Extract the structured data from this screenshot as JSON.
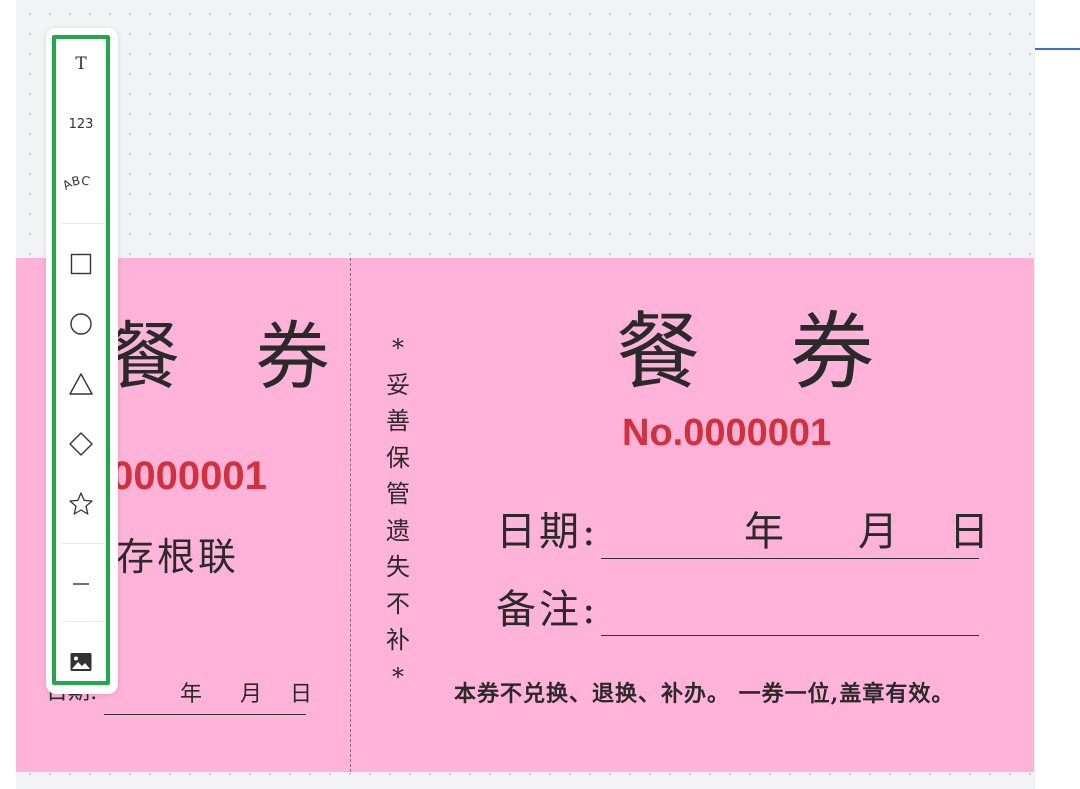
{
  "toolbar": {
    "tools": [
      {
        "id": "text",
        "icon": "text-icon",
        "glyph": "T"
      },
      {
        "id": "number",
        "icon": "number-icon",
        "glyph": "123"
      },
      {
        "id": "curved-text",
        "icon": "curved-text-icon",
        "glyph": "ABC"
      },
      {
        "id": "rectangle",
        "icon": "rectangle-icon"
      },
      {
        "id": "circle",
        "icon": "circle-icon"
      },
      {
        "id": "triangle",
        "icon": "triangle-icon"
      },
      {
        "id": "diamond",
        "icon": "diamond-icon"
      },
      {
        "id": "star",
        "icon": "star-icon"
      },
      {
        "id": "line",
        "icon": "line-icon"
      },
      {
        "id": "image",
        "icon": "image-icon"
      }
    ],
    "highlight_color": "#1faa49"
  },
  "ticket": {
    "background_color": "#ffb3d9",
    "accent_color": "#d2303a",
    "stub": {
      "title": "餐 券",
      "number": ".0000001",
      "label": "存根联",
      "date_label": "日期:",
      "year": "年",
      "month": "月",
      "day": "日"
    },
    "notice": "*妥善保管 遗失不补*",
    "main": {
      "title": "餐券",
      "number": "No.0000001",
      "date_label": "日期:",
      "year": "年",
      "month": "月",
      "day": "日",
      "remark_label": "备注:",
      "footer": "本券不兑换、退换、补办。 一券一位,盖章有效。"
    }
  }
}
